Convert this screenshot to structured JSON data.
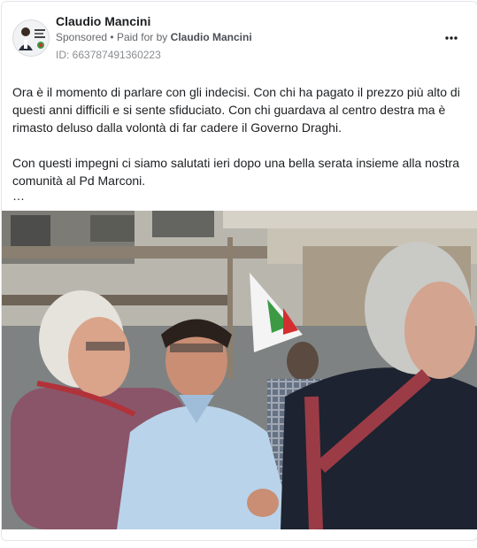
{
  "post": {
    "author_name": "Claudio Mancini",
    "sponsored_label": "Sponsored",
    "separator": "•",
    "paid_prefix": "Paid for by",
    "paid_by": "Claudio Mancini",
    "ad_id": "ID: 663787491360223",
    "more_options_icon": "more-horizontal-icon",
    "paragraph_1": "Ora è il momento di parlare con gli indecisi. Con chi ha pagato il prezzo più alto di questi anni difficili e si sente sfiduciato. Con chi guardava al centro destra ma è rimasto deluso dalla volontà di far cadere il Governo Draghi.",
    "paragraph_2": "Con questi impegni ci siamo salutati ieri dopo una bella serata insieme alla nostra comunità al Pd Marconi.",
    "truncation": "…"
  },
  "colors": {
    "text_primary": "#1c1e21",
    "text_secondary": "#65676b",
    "border": "#e4e6eb"
  }
}
